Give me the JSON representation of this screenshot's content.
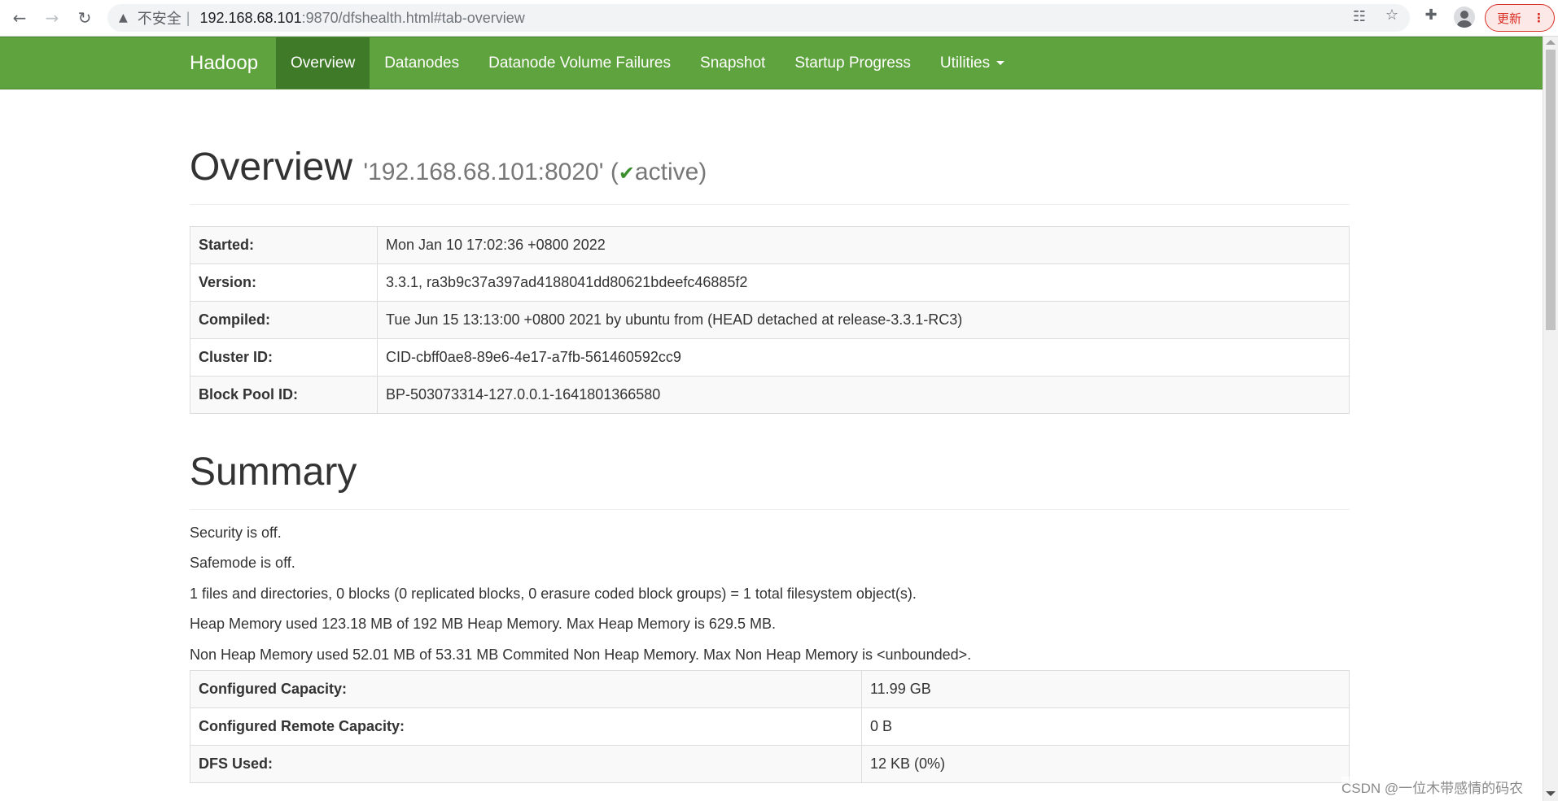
{
  "browser": {
    "url_insecure": "不安全",
    "url_separator": "|",
    "url_host": "192.168.68.101",
    "url_rest": ":9870/dfshealth.html#tab-overview",
    "update_label": "更新"
  },
  "navbar": {
    "brand": "Hadoop",
    "items": [
      {
        "label": "Overview"
      },
      {
        "label": "Datanodes"
      },
      {
        "label": "Datanode Volume Failures"
      },
      {
        "label": "Snapshot"
      },
      {
        "label": "Startup Progress"
      },
      {
        "label": "Utilities"
      }
    ]
  },
  "overview": {
    "title": "Overview",
    "address": "'192.168.68.101:8020'",
    "status_open": "(",
    "status": "active",
    "status_close": ")",
    "rows": [
      {
        "label": "Started:",
        "value": "Mon Jan 10 17:02:36 +0800 2022"
      },
      {
        "label": "Version:",
        "value": "3.3.1, ra3b9c37a397ad4188041dd80621bdeefc46885f2"
      },
      {
        "label": "Compiled:",
        "value": "Tue Jun 15 13:13:00 +0800 2021 by ubuntu from (HEAD detached at release-3.3.1-RC3)"
      },
      {
        "label": "Cluster ID:",
        "value": "CID-cbff0ae8-89e6-4e17-a7fb-561460592cc9"
      },
      {
        "label": "Block Pool ID:",
        "value": "BP-503073314-127.0.0.1-1641801366580"
      }
    ]
  },
  "summary": {
    "title": "Summary",
    "lines": [
      "Security is off.",
      "Safemode is off.",
      "1 files and directories, 0 blocks (0 replicated blocks, 0 erasure coded block groups) = 1 total filesystem object(s).",
      "Heap Memory used 123.18 MB of 192 MB Heap Memory. Max Heap Memory is 629.5 MB.",
      "Non Heap Memory used 52.01 MB of 53.31 MB Commited Non Heap Memory. Max Non Heap Memory is <unbounded>."
    ],
    "rows": [
      {
        "label": "Configured Capacity:",
        "value": "11.99 GB"
      },
      {
        "label": "Configured Remote Capacity:",
        "value": "0 B"
      },
      {
        "label": "DFS Used:",
        "value": "12 KB (0%)"
      }
    ]
  },
  "watermark": "CSDN @一位木带感情的码农",
  "colors": {
    "navbar": "#5fa33e",
    "navbar_active": "#3e7a27",
    "status_check": "#3c8f2d"
  },
  "icons": [
    "back-arrow-icon",
    "forward-arrow-icon",
    "reload-icon",
    "warning-icon",
    "translate-icon",
    "star-icon",
    "extensions-icon",
    "profile-icon",
    "menu-dots-icon",
    "check-icon"
  ]
}
